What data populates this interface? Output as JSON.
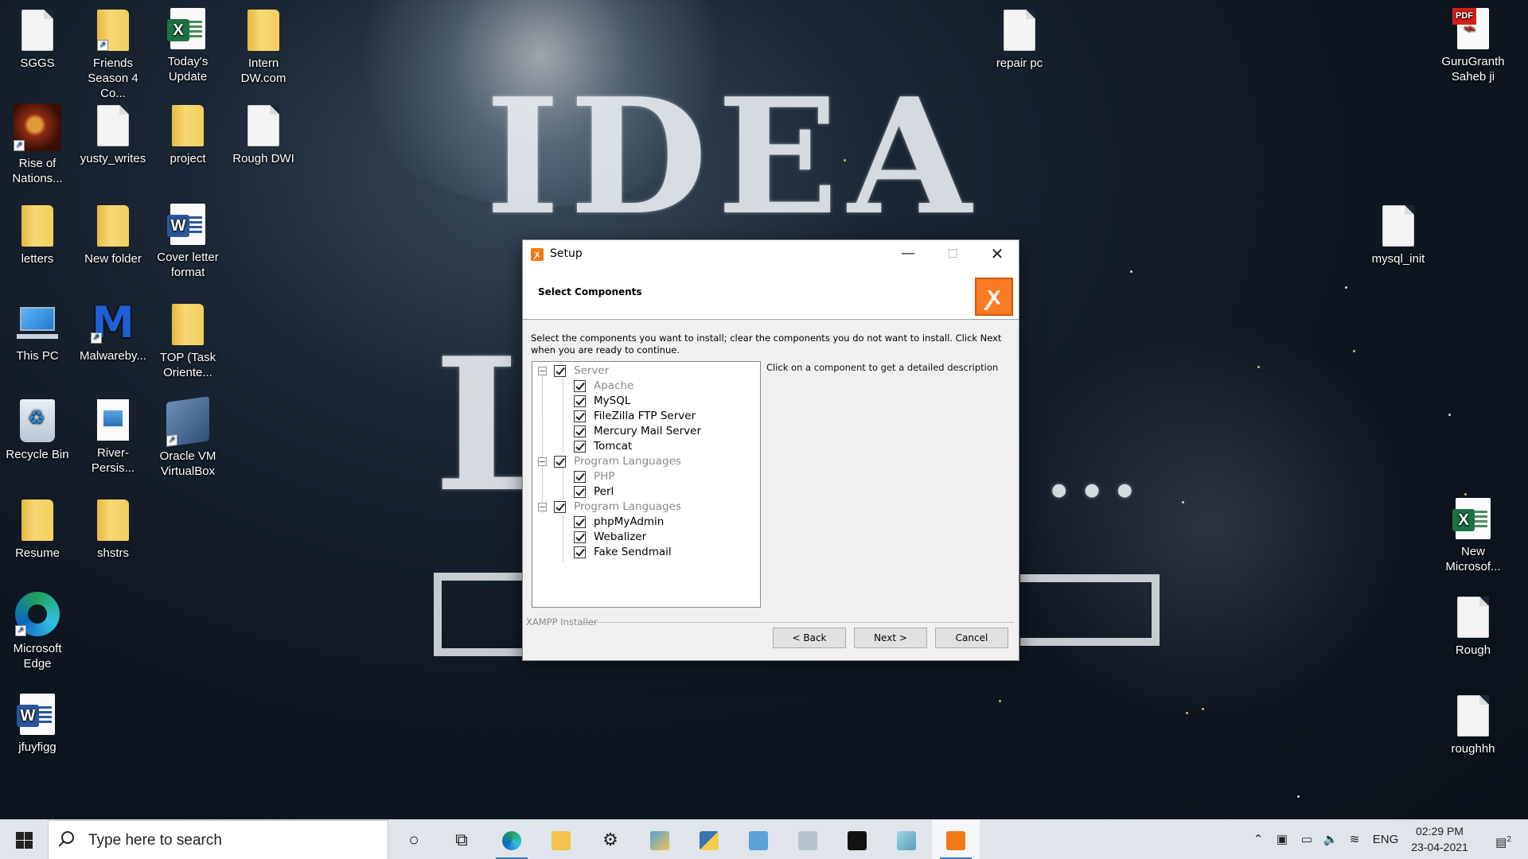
{
  "desktop": {
    "icons": [
      {
        "label": "SGGS"
      },
      {
        "label": "Friends Season 4 Co..."
      },
      {
        "label": "Today's Update"
      },
      {
        "label": "Intern DW.com"
      },
      {
        "label": "repair pc"
      },
      {
        "label": "GuruGranth Saheb ji"
      },
      {
        "label": "Rise of Nations..."
      },
      {
        "label": "yusty_writes"
      },
      {
        "label": "project"
      },
      {
        "label": "Rough DWI"
      },
      {
        "label": "letters"
      },
      {
        "label": "New folder"
      },
      {
        "label": "Cover letter format"
      },
      {
        "label": "mysql_init"
      },
      {
        "label": "This PC"
      },
      {
        "label": "Malwareby..."
      },
      {
        "label": "TOP (Task Oriente..."
      },
      {
        "label": "Recycle Bin"
      },
      {
        "label": "River-Persis..."
      },
      {
        "label": "Oracle VM VirtualBox"
      },
      {
        "label": "Resume"
      },
      {
        "label": "shstrs"
      },
      {
        "label": "New Microsof..."
      },
      {
        "label": "Microsoft Edge"
      },
      {
        "label": "Rough"
      },
      {
        "label": "jfuyfigg"
      },
      {
        "label": "roughhh"
      }
    ],
    "pdf_tag": "PDF",
    "excel_letter": "X",
    "word_letter": "W"
  },
  "dialog": {
    "title": "Setup",
    "header_title": "Select Components",
    "intro": "Select the components you want to install; clear the components you do not want to install. Click Next when you are ready to continue.",
    "description": "Click on a component to get a detailed description",
    "brand": "XAMPP Installer",
    "logo_glyph": "ꭗ",
    "tree": [
      {
        "label": "Server",
        "level": 0,
        "checked": true,
        "enabled": false
      },
      {
        "label": "Apache",
        "level": 1,
        "checked": true,
        "enabled": false
      },
      {
        "label": "MySQL",
        "level": 1,
        "checked": true,
        "enabled": true
      },
      {
        "label": "FileZilla FTP Server",
        "level": 1,
        "checked": true,
        "enabled": true
      },
      {
        "label": "Mercury Mail Server",
        "level": 1,
        "checked": true,
        "enabled": true
      },
      {
        "label": "Tomcat",
        "level": 1,
        "checked": true,
        "enabled": true
      },
      {
        "label": "Program Languages",
        "level": 0,
        "checked": true,
        "enabled": false
      },
      {
        "label": "PHP",
        "level": 1,
        "checked": true,
        "enabled": false
      },
      {
        "label": "Perl",
        "level": 1,
        "checked": true,
        "enabled": true
      },
      {
        "label": "Program Languages",
        "level": 0,
        "checked": true,
        "enabled": false
      },
      {
        "label": "phpMyAdmin",
        "level": 1,
        "checked": true,
        "enabled": true
      },
      {
        "label": "Webalizer",
        "level": 1,
        "checked": true,
        "enabled": true
      },
      {
        "label": "Fake Sendmail",
        "level": 1,
        "checked": true,
        "enabled": true
      }
    ],
    "buttons": {
      "back": "< Back",
      "next": "Next >",
      "cancel": "Cancel"
    }
  },
  "wallpaper": {
    "line1": "IDEA",
    "line2": "L",
    "dots": "..."
  },
  "taskbar": {
    "search_placeholder": "Type here to search",
    "tray": {
      "language": "ENG",
      "time": "02:29 PM",
      "date": "23-04-2021",
      "notifications": "2"
    }
  }
}
